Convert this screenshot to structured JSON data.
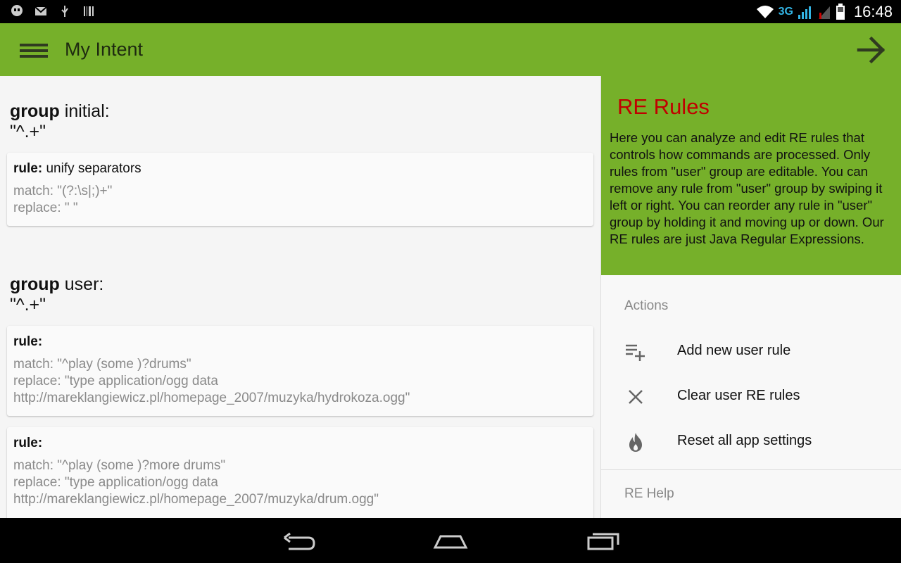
{
  "status_bar": {
    "left_icons": [
      "hangouts-icon",
      "gmail-icon",
      "usb-icon",
      "barcode-icon"
    ],
    "network": "3G",
    "time": "16:48"
  },
  "app_bar": {
    "title": "My Intent"
  },
  "groups": [
    {
      "keyword": "group",
      "name": " initial:",
      "pattern": "\"^.+\"",
      "rules": [
        {
          "label": "rule:",
          "name": " unify separators",
          "match": "match: \"(?:\\s|;)+\"",
          "replace": "replace: \" \""
        }
      ]
    },
    {
      "keyword": "group",
      "name": " user:",
      "pattern": "\"^.+\"",
      "rules": [
        {
          "label": "rule:",
          "name": "",
          "match": "match: \"^play (some )?drums\"",
          "replace": "replace: \"type application/ogg data http://mareklangiewicz.pl/homepage_2007/muzyka/hydrokoza.ogg\""
        },
        {
          "label": "rule:",
          "name": "",
          "match": "match: \"^play (some )?more drums\"",
          "replace": "replace: \"type application/ogg data http://mareklangiewicz.pl/homepage_2007/muzyka/drum.ogg\""
        }
      ]
    }
  ],
  "drawer": {
    "title": "RE Rules",
    "description": "Here you can analyze and edit RE rules that controls how commands are processed. Only rules from \"user\" group are editable. You can remove any rule from \"user\" group by swiping it left or right. You can reorder any rule in \"user\" group by holding it and moving up or down. Our RE rules are just Java Regular Expressions.",
    "actions_label": "Actions",
    "actions": [
      {
        "label": "Add new user rule",
        "icon": "playlist-add-icon"
      },
      {
        "label": "Clear user RE rules",
        "icon": "close-icon"
      },
      {
        "label": "Reset all app settings",
        "icon": "flame-icon"
      }
    ],
    "help_label": "RE Help"
  },
  "colors": {
    "accent_green": "#76b02a",
    "title_red": "#c00000"
  }
}
